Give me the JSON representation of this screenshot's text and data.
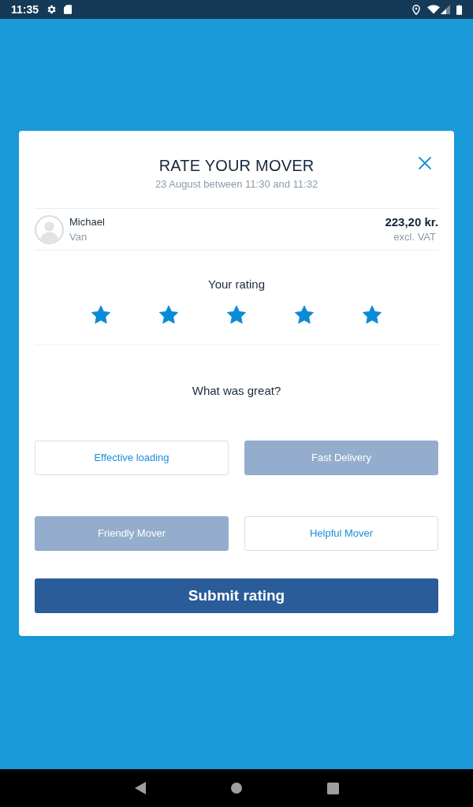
{
  "status_bar": {
    "time": "11:35"
  },
  "dialog": {
    "title": "RATE YOUR MOVER",
    "subtitle": "23 August between 11:30 and 11:32"
  },
  "mover": {
    "name": "Michael",
    "vehicle": "Van",
    "price": "223,20 kr.",
    "price_note": "excl. VAT"
  },
  "rating": {
    "label": "Your rating",
    "stars": 5
  },
  "highlights": {
    "question": "What was great?",
    "tags": [
      {
        "label": "Effective loading",
        "selected": false
      },
      {
        "label": "Fast Delivery",
        "selected": true
      },
      {
        "label": "Friendly Mover",
        "selected": true
      },
      {
        "label": "Helpful Mover",
        "selected": false
      }
    ]
  },
  "submit_button": "Submit rating"
}
